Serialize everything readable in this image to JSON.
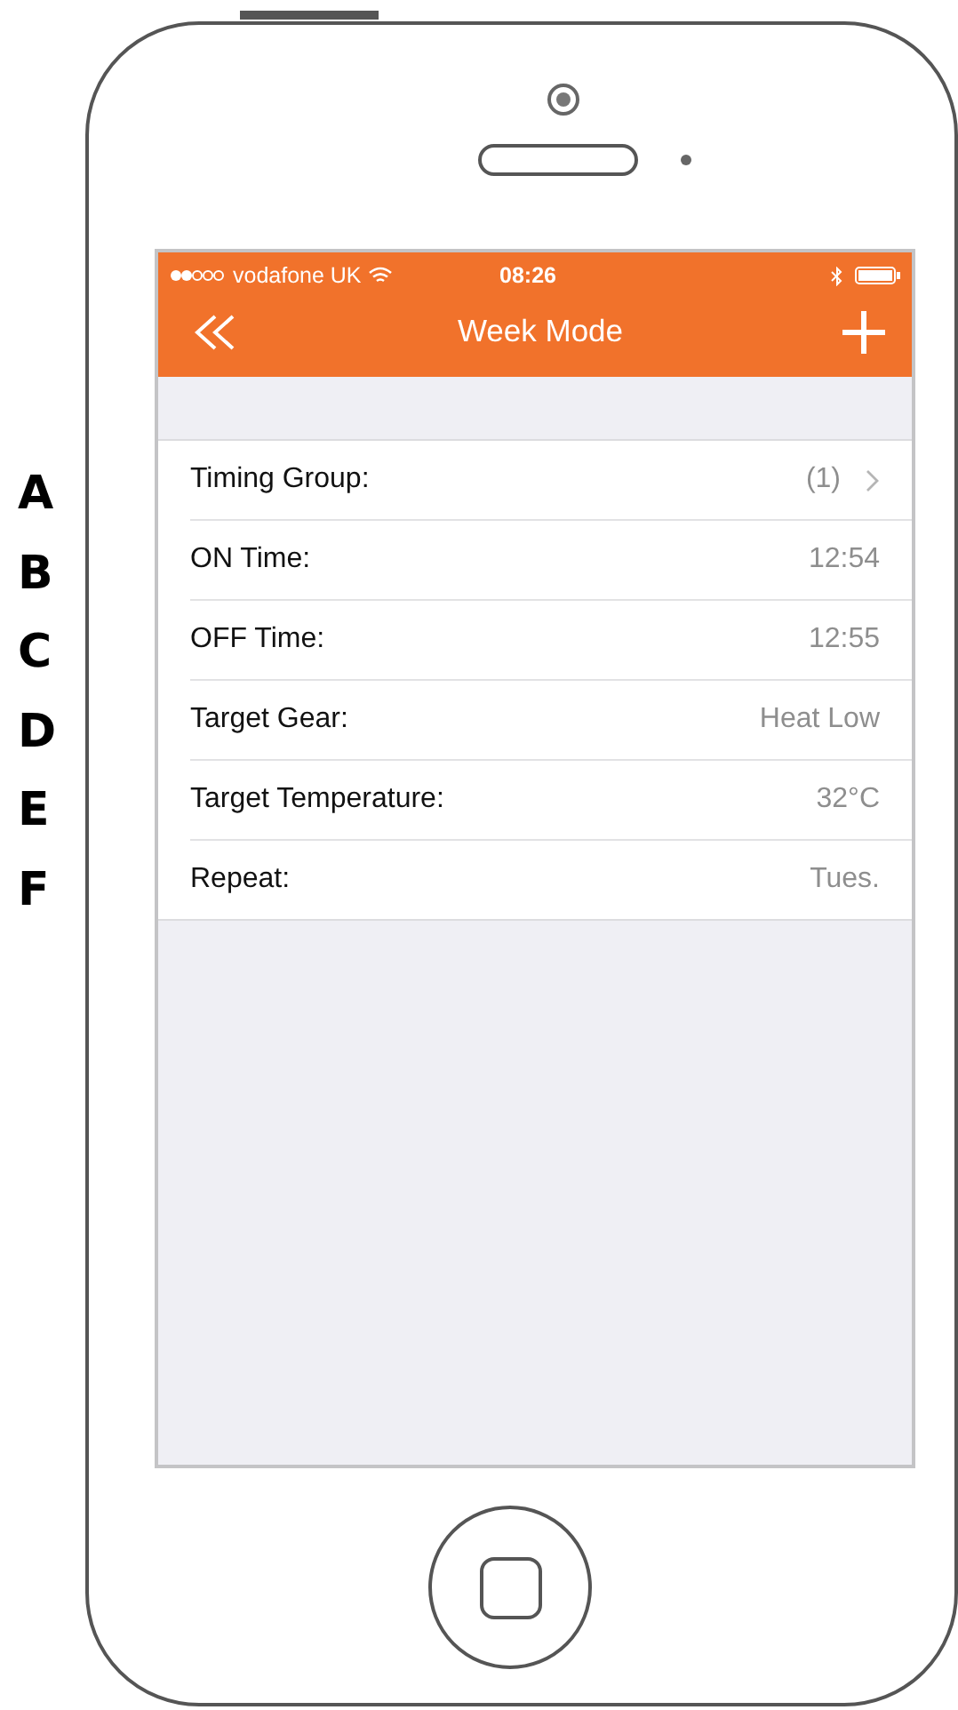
{
  "callouts": [
    "A",
    "B",
    "C",
    "D",
    "E",
    "F"
  ],
  "status_bar": {
    "carrier": "vodafone UK",
    "time": "08:26"
  },
  "nav": {
    "title": "Week Mode"
  },
  "rows": [
    {
      "kind": "link",
      "label": "Timing Group:",
      "value": "(1)"
    },
    {
      "kind": "plain",
      "label": "ON Time:",
      "value": "12:54"
    },
    {
      "kind": "plain",
      "label": "OFF Time:",
      "value": "12:55"
    },
    {
      "kind": "plain",
      "label": "Target Gear:",
      "value": "Heat Low"
    },
    {
      "kind": "plain",
      "label": "Target Temperature:",
      "value": "32°C"
    },
    {
      "kind": "plain",
      "label": "Repeat:",
      "value": "Tues."
    }
  ]
}
